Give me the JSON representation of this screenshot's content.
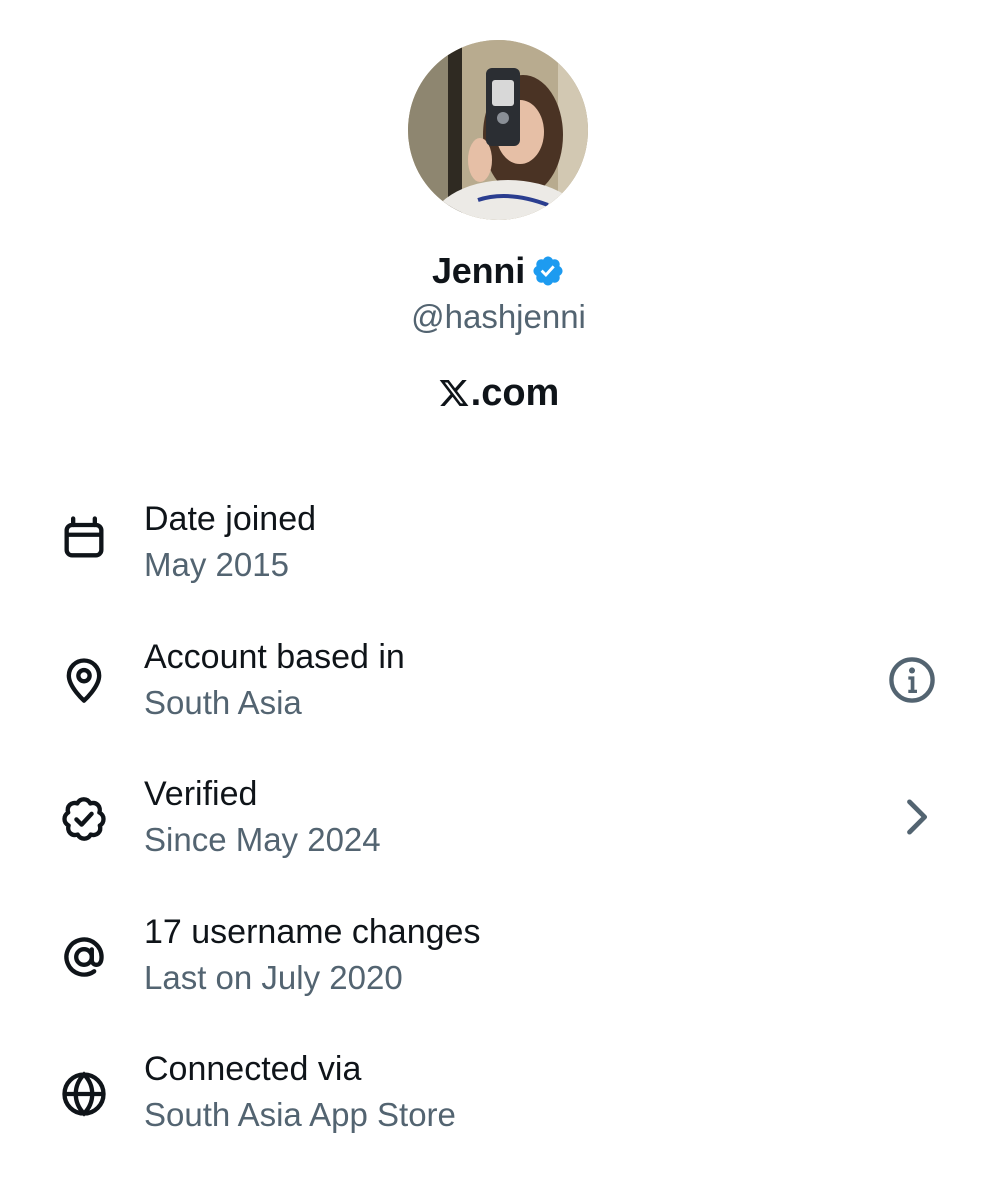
{
  "profile": {
    "display_name": "Jenni",
    "handle": "@hashjenni",
    "site": ".com",
    "avatar_icon": "profile-photo",
    "verified_color": "#1d9bf0"
  },
  "rows": [
    {
      "title": "Date joined",
      "subtitle": "May 2015",
      "icon": "calendar-icon"
    },
    {
      "title": "Account based in",
      "subtitle": "South Asia",
      "icon": "location-pin-icon",
      "action_icon": "info-icon"
    },
    {
      "title": "Verified",
      "subtitle": "Since May 2024",
      "icon": "verified-outline-icon",
      "action_icon": "chevron-right-icon"
    },
    {
      "title": "17 username changes",
      "subtitle": "Last on July 2020",
      "icon": "at-sign-icon"
    },
    {
      "title": "Connected via",
      "subtitle": "South Asia App Store",
      "icon": "globe-icon"
    }
  ],
  "colors": {
    "primary_text": "#0f1419",
    "secondary_text": "#536471",
    "accent": "#1d9bf0"
  }
}
